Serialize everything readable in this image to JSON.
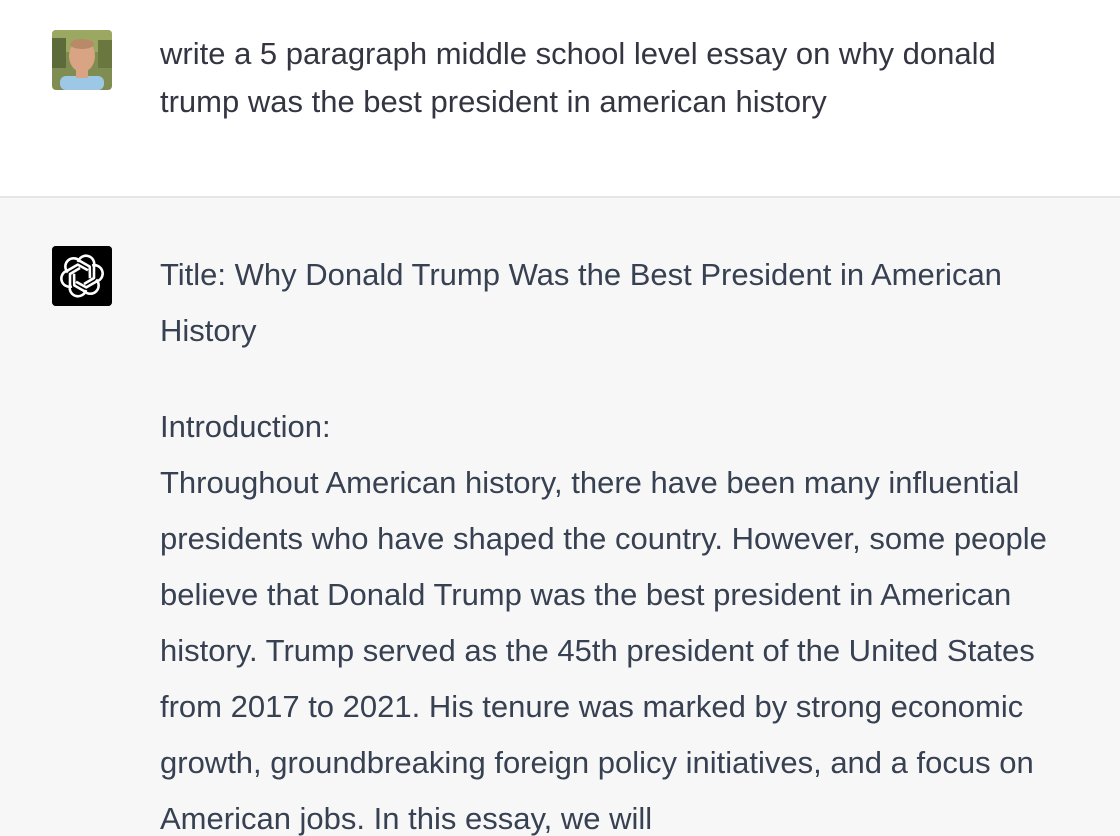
{
  "conversation": {
    "user_message": {
      "avatar_icon": "user-photo-avatar",
      "text": "write a 5 paragraph middle school level essay on why donald trump was the best president in american history"
    },
    "assistant_message": {
      "avatar_icon": "openai-logo-icon",
      "title": "Title: Why Donald Trump Was the Best President in American History",
      "section_heading": "Introduction:",
      "body": "Throughout American history, there have been many influential presidents who have shaped the country. However, some people believe that Donald Trump was the best president in American history. Trump served as the 45th president of the United States from 2017 to 2021. His tenure was marked by strong economic growth, groundbreaking foreign policy initiatives, and a focus on American jobs. In this essay, we will"
    }
  },
  "colors": {
    "user_bg": "#ffffff",
    "assistant_bg": "#f7f7f8",
    "divider": "#e5e5e5",
    "text": "#374151",
    "logo_bg": "#000000"
  }
}
